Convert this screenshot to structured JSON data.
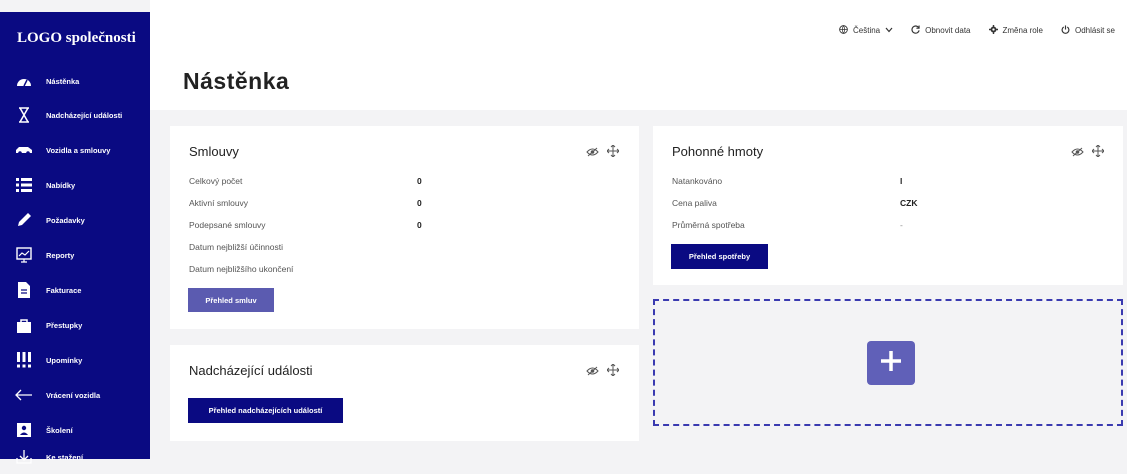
{
  "sidebar": {
    "logo": "LOGO společnosti",
    "items": [
      {
        "label": "Nástěnka",
        "icon": "dashboard-icon"
      },
      {
        "label": "Nadcházející události",
        "icon": "hourglass-icon"
      },
      {
        "label": "Vozidla a smlouvy",
        "icon": "car-icon"
      },
      {
        "label": "Nabídky",
        "icon": "list-icon"
      },
      {
        "label": "Požadavky",
        "icon": "pencil-icon"
      },
      {
        "label": "Reporty",
        "icon": "chart-icon"
      },
      {
        "label": "Fakturace",
        "icon": "invoice-icon"
      },
      {
        "label": "Přestupky",
        "icon": "bag-icon"
      },
      {
        "label": "Upomínky",
        "icon": "exclamation-icon"
      },
      {
        "label": "Vrácení vozidla",
        "icon": "return-arrow-icon"
      },
      {
        "label": "Školení",
        "icon": "training-icon"
      },
      {
        "label": "Ke stažení",
        "icon": "download-icon"
      }
    ]
  },
  "header": {
    "language": "Čeština",
    "refresh": "Obnovit data",
    "change_role": "Změna role",
    "logout": "Odhlásit se",
    "title": "Nástěnka"
  },
  "contracts": {
    "title": "Smlouvy",
    "rows": [
      {
        "label": "Celkový počet",
        "value": "0"
      },
      {
        "label": "Aktivní smlouvy",
        "value": "0"
      },
      {
        "label": "Podepsané smlouvy",
        "value": "0"
      },
      {
        "label": "Datum nejbližší účinnosti",
        "value": ""
      },
      {
        "label": "Datum nejbližšího ukončení",
        "value": ""
      }
    ],
    "button": "Přehled smluv"
  },
  "fuel": {
    "title": "Pohonné hmoty",
    "rows": [
      {
        "label": "Natankováno",
        "value": "l"
      },
      {
        "label": "Cena paliva",
        "value": "CZK"
      },
      {
        "label": "Průměrná spotřeba",
        "value": "-"
      }
    ],
    "button": "Přehled spotřeby"
  },
  "events": {
    "title": "Nadcházející události",
    "button": "Přehled nadcházejících událostí"
  },
  "colors": {
    "primary": "#0a0a82",
    "button_light": "#5b5bb0",
    "add_button": "#6060b8"
  }
}
